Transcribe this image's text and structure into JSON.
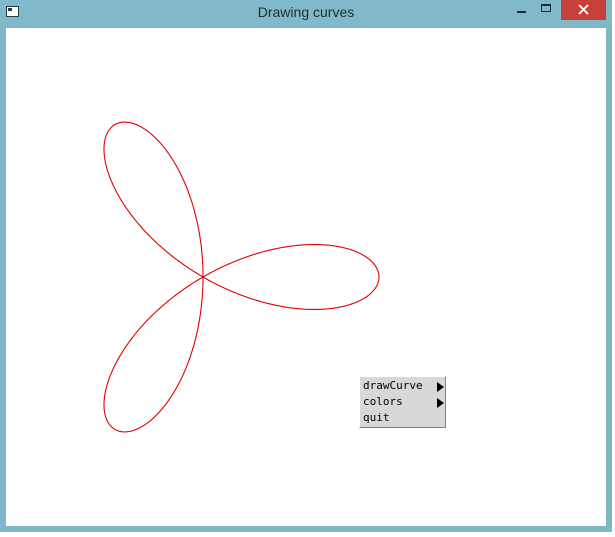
{
  "window": {
    "title": "Drawing curves",
    "accent_color": "#80b9c9",
    "close_color": "#c7403a"
  },
  "titlebar": {
    "icons": {
      "app": "app-window-icon",
      "minimize": "minimize-icon",
      "maximize": "maximize-icon",
      "close": "close-icon"
    }
  },
  "canvas": {
    "curve": {
      "name": "three-petal rose",
      "petals": 3,
      "color": "#e00000"
    }
  },
  "context_menu": {
    "items": [
      {
        "label": "drawCurve",
        "has_submenu": true
      },
      {
        "label": "colors",
        "has_submenu": true
      },
      {
        "label": "quit",
        "has_submenu": false
      }
    ]
  }
}
